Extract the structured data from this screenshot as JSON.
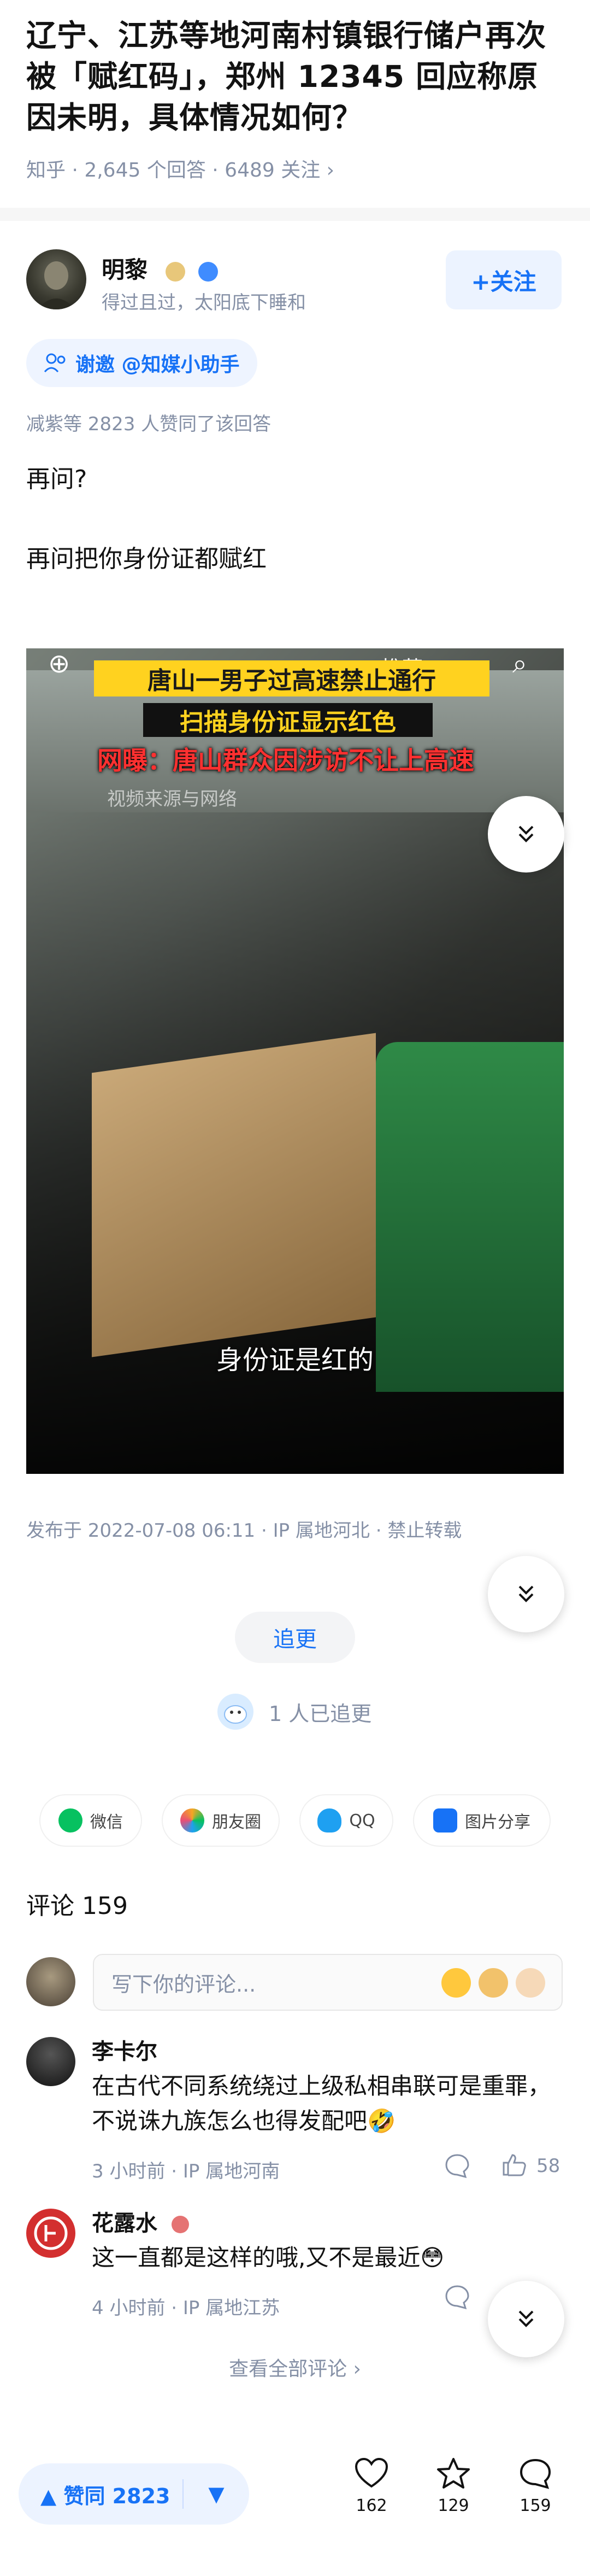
{
  "question": {
    "title": "辽宁、江苏等地河南村镇银行储户再次被「赋红码」，郑州 12345 回应称原因未明，具体情况如何？",
    "meta": "知乎 · 2,645 个回答 · 6489 关注 ›"
  },
  "author": {
    "name": "明黎",
    "bio": "得过且过，太阳底下睡和",
    "follow_label": "+关注"
  },
  "invite": {
    "label": "谢邀 @知媒小助手"
  },
  "voters_text": "减紫等 2823 人赞同了该回答",
  "answer": {
    "paragraph_1": "再问?",
    "paragraph_2": "再问把你身份证都赋红"
  },
  "video": {
    "top_tabs": "推荐",
    "banner_1": "唐山一男子过高速禁止通行",
    "banner_2": "扫描身份证显示红色",
    "banner_3": "网曝：唐山群众因涉访不让上高速",
    "source": "视频来源与网络",
    "caption": "身份证是红的"
  },
  "publish_info": "发布于 2022-07-08 06:11 · IP 属地河北 · 禁止转载",
  "follow_more": {
    "label": "追更",
    "followers": "1 人已追更"
  },
  "share": [
    {
      "label": "微信",
      "icon": "wechat-icon",
      "color": "#07c160"
    },
    {
      "label": "朋友圈",
      "icon": "moments-icon",
      "color": "#f5a623"
    },
    {
      "label": "QQ",
      "icon": "qq-icon",
      "color": "#1ea0f1"
    },
    {
      "label": "图片分享",
      "icon": "image-share-icon",
      "color": "#1772f6"
    }
  ],
  "comments": {
    "title": "评论 159",
    "input_placeholder": "写下你的评论...",
    "items": [
      {
        "name": "李卡尔",
        "text": "在古代不同系统绕过上级私相串联可是重罪，不说诛九族怎么也得发配吧🤣",
        "meta": "3 小时前 · IP 属地河南",
        "likes": "58"
      },
      {
        "name": "花露水",
        "text": "这一直都是这样的哦,又不是最近😳",
        "meta": "4 小时前 · IP 属地江苏",
        "likes": ""
      }
    ],
    "see_all": "查看全部评论 ›"
  },
  "bottom_bar": {
    "vote_up": "赞同 2823",
    "likes": "162",
    "favorites": "129",
    "comments": "159"
  },
  "colors": {
    "accent": "#1772f6",
    "muted": "#8590a6",
    "banner_yellow": "#ffd21f",
    "banner_red": "#ff3030"
  }
}
